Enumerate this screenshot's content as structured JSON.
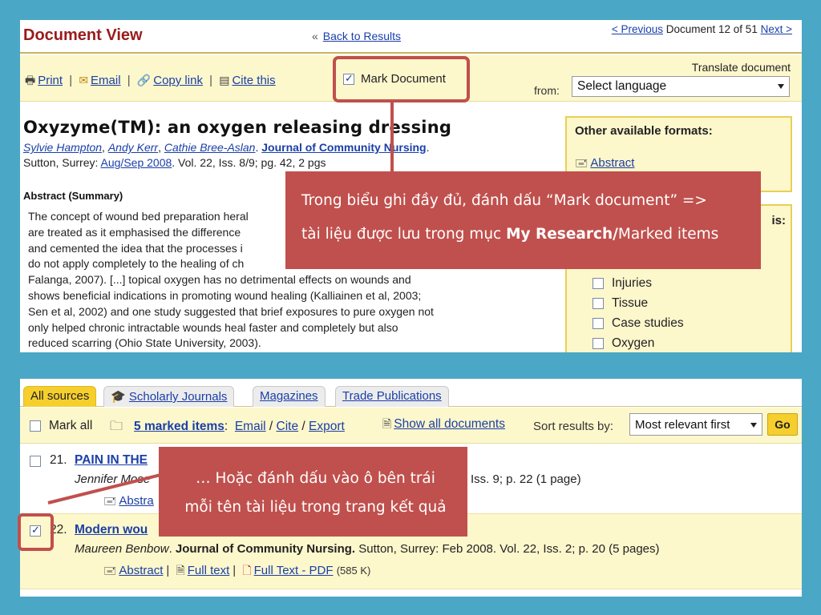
{
  "document_view": {
    "title": "Document View",
    "back_arrows": "«",
    "back_link": "Back to Results",
    "prev_link": "< Previous",
    "doc_position": "Document 12 of 51",
    "next_link": "Next >"
  },
  "toolbar": {
    "print": "Print",
    "email": "Email",
    "copy_link": "Copy link",
    "cite": "Cite this",
    "separator": "|",
    "mark_document": "Mark Document",
    "translate_label": "Translate document",
    "from_label": "from:",
    "language_select": "Select language"
  },
  "article": {
    "title": "Oxyzyme(TM): an oxygen releasing dressing",
    "authors": [
      "Sylvie Hampton",
      "Andy Kerr",
      "Cathie Bree-Aslan"
    ],
    "journal": "Journal of Community Nursing",
    "source_prefix": "Sutton, Surrey:",
    "date": "Aug/Sep 2008",
    "source_suffix": ". Vol. 22, Iss. 8/9; pg. 42, 2 pgs",
    "abstract_heading": "Abstract (Summary)",
    "abstract_lines": [
      "The concept of wound bed preparation heral",
      "are treated as it emphasised the difference",
      "and cemented the idea that the processes i",
      "do not apply completely to the healing of ch",
      "Falanga, 2007). [...] topical oxygen has no detrimental effects on wounds and",
      "shows beneficial indications in promoting wound healing (Kalliainen et al, 2003;",
      "Sen et al, 2002) and one study suggested that brief exposures to pure oxygen not",
      "only helped chronic intractable wounds heal faster and completely but also",
      "reduced scarring (Ohio State University, 2003)."
    ]
  },
  "formats": {
    "title": "Other available formats:",
    "abstract": "Abstract"
  },
  "subjects": {
    "title_suffix": "is:",
    "items": [
      "Injuries",
      "Tissue",
      "Case studies",
      "Oxygen"
    ]
  },
  "callout_1": {
    "line1": "Trong biểu ghi đầy đủ, đánh dấu “Mark document”  =>",
    "line2_prefix": "tài liệu được lưu trong mục ",
    "line2_bold": "My Research/",
    "line2_suffix": "Marked items"
  },
  "tabs": [
    "All sources",
    "Scholarly Journals",
    "Magazines",
    "Trade Publications"
  ],
  "results_bar": {
    "mark_all": "Mark all",
    "marked_count": "5 marked items",
    "colon": ":",
    "email": "Email",
    "cite": "Cite",
    "export": "Export",
    "slash": "/",
    "show_all": "Show all documents",
    "sort_label": "Sort results by:",
    "sort_value": "Most relevant first",
    "go": "Go"
  },
  "results": [
    {
      "number": "21.",
      "title": "PAIN IN THE",
      "author": "Jennifer Mose",
      "meta_right": "Iss. 9; p. 22 (1 page)",
      "link_abstract": "Abstra",
      "checked": false
    },
    {
      "number": "22.",
      "title": "Modern wou",
      "author": "Maureen Benbow",
      "journal": "Journal of Community Nursing.",
      "meta_rest": " Sutton, Surrey: Feb 2008. Vol. 22, Iss. 2; p. 20 (5 pages)",
      "link_abstract": "Abstract",
      "link_fulltext": "Full text",
      "link_pdf": "Full Text - PDF",
      "pdf_size": "(585 K)",
      "checked": true
    }
  ],
  "callout_2": {
    "line1": "… Hoặc đánh dấu vào ô bên trái",
    "line2": "mỗi tên tài liệu trong trang kết quả"
  },
  "colors": {
    "background": "#4ba7c6",
    "callout": "#c0504d",
    "toolbar": "#fdf7cc",
    "title_red": "#9a1b1b",
    "active_tab": "#f6cf2e"
  }
}
